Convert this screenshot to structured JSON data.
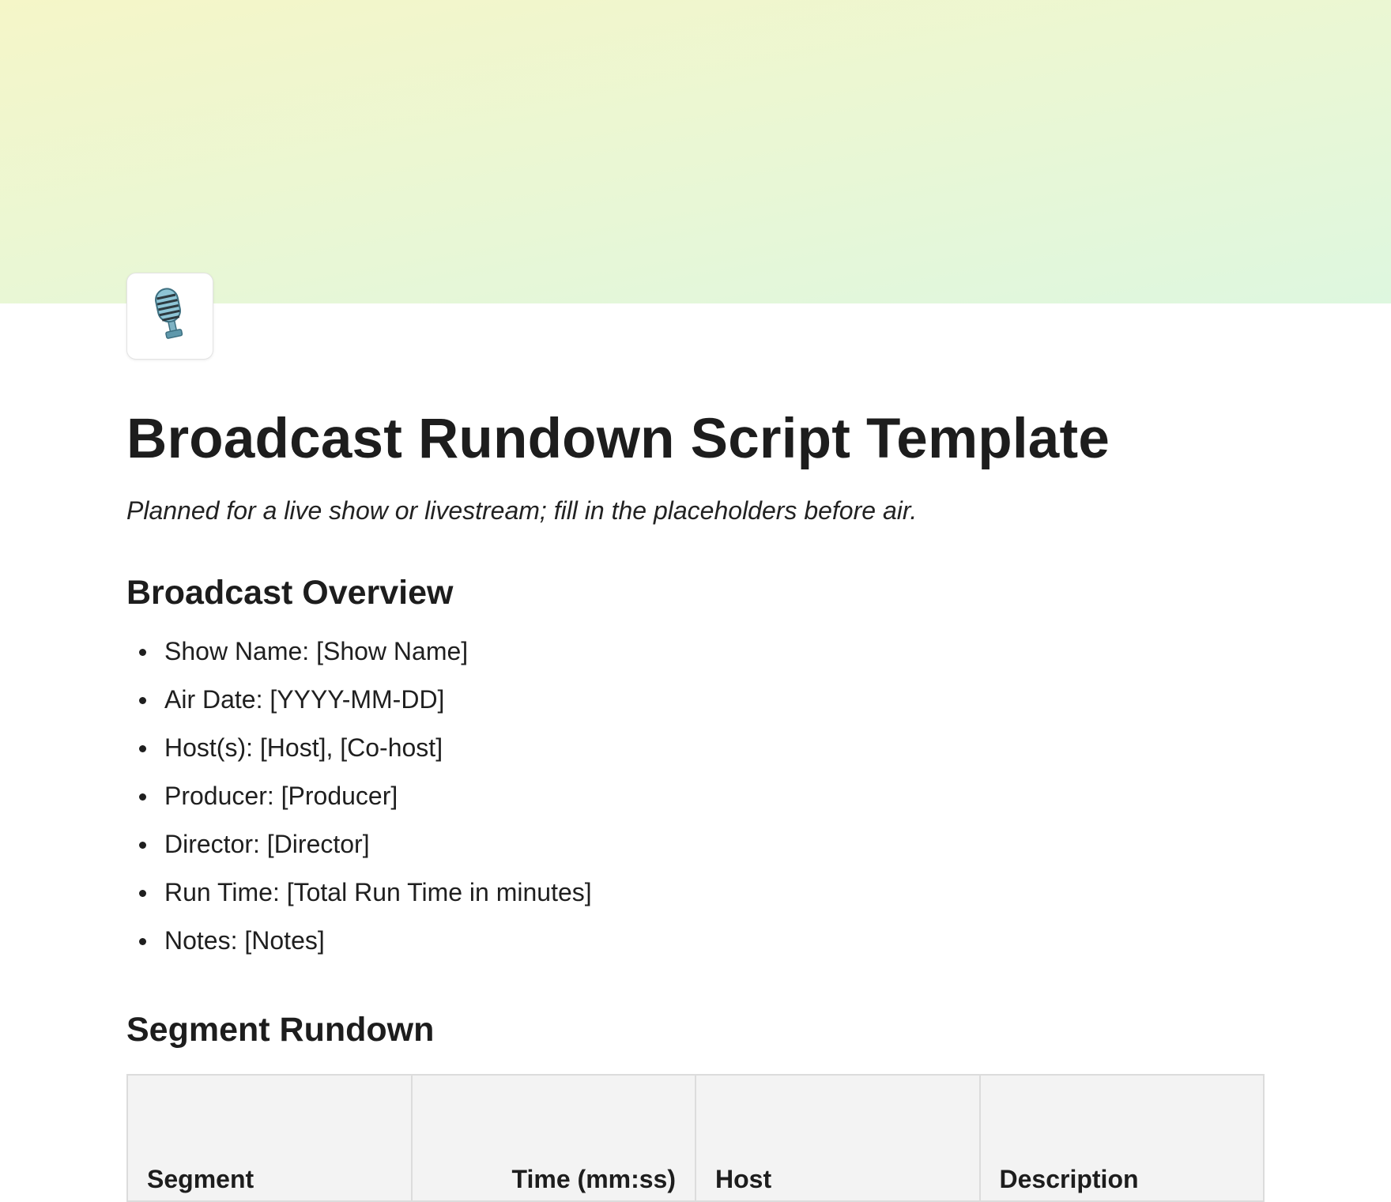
{
  "page": {
    "icon": "microphone-icon",
    "title": "Broadcast Rundown Script Template",
    "subtitle": "Planned for a live show or livestream; fill in the placeholders before air.",
    "cover_colors": [
      "#f5f6c8",
      "#eaf7d4",
      "#def7df"
    ]
  },
  "overview": {
    "heading": "Broadcast Overview",
    "items": [
      "Show Name: [Show Name]",
      "Air Date: [YYYY-MM-DD]",
      "Host(s): [Host], [Co-host]",
      "Producer: [Producer]",
      "Director: [Director]",
      "Run Time: [Total Run Time in minutes]",
      "Notes: [Notes]"
    ]
  },
  "segments": {
    "heading": "Segment Rundown",
    "columns": [
      "Segment",
      "Time (mm:ss)",
      "Host",
      "Description"
    ]
  }
}
